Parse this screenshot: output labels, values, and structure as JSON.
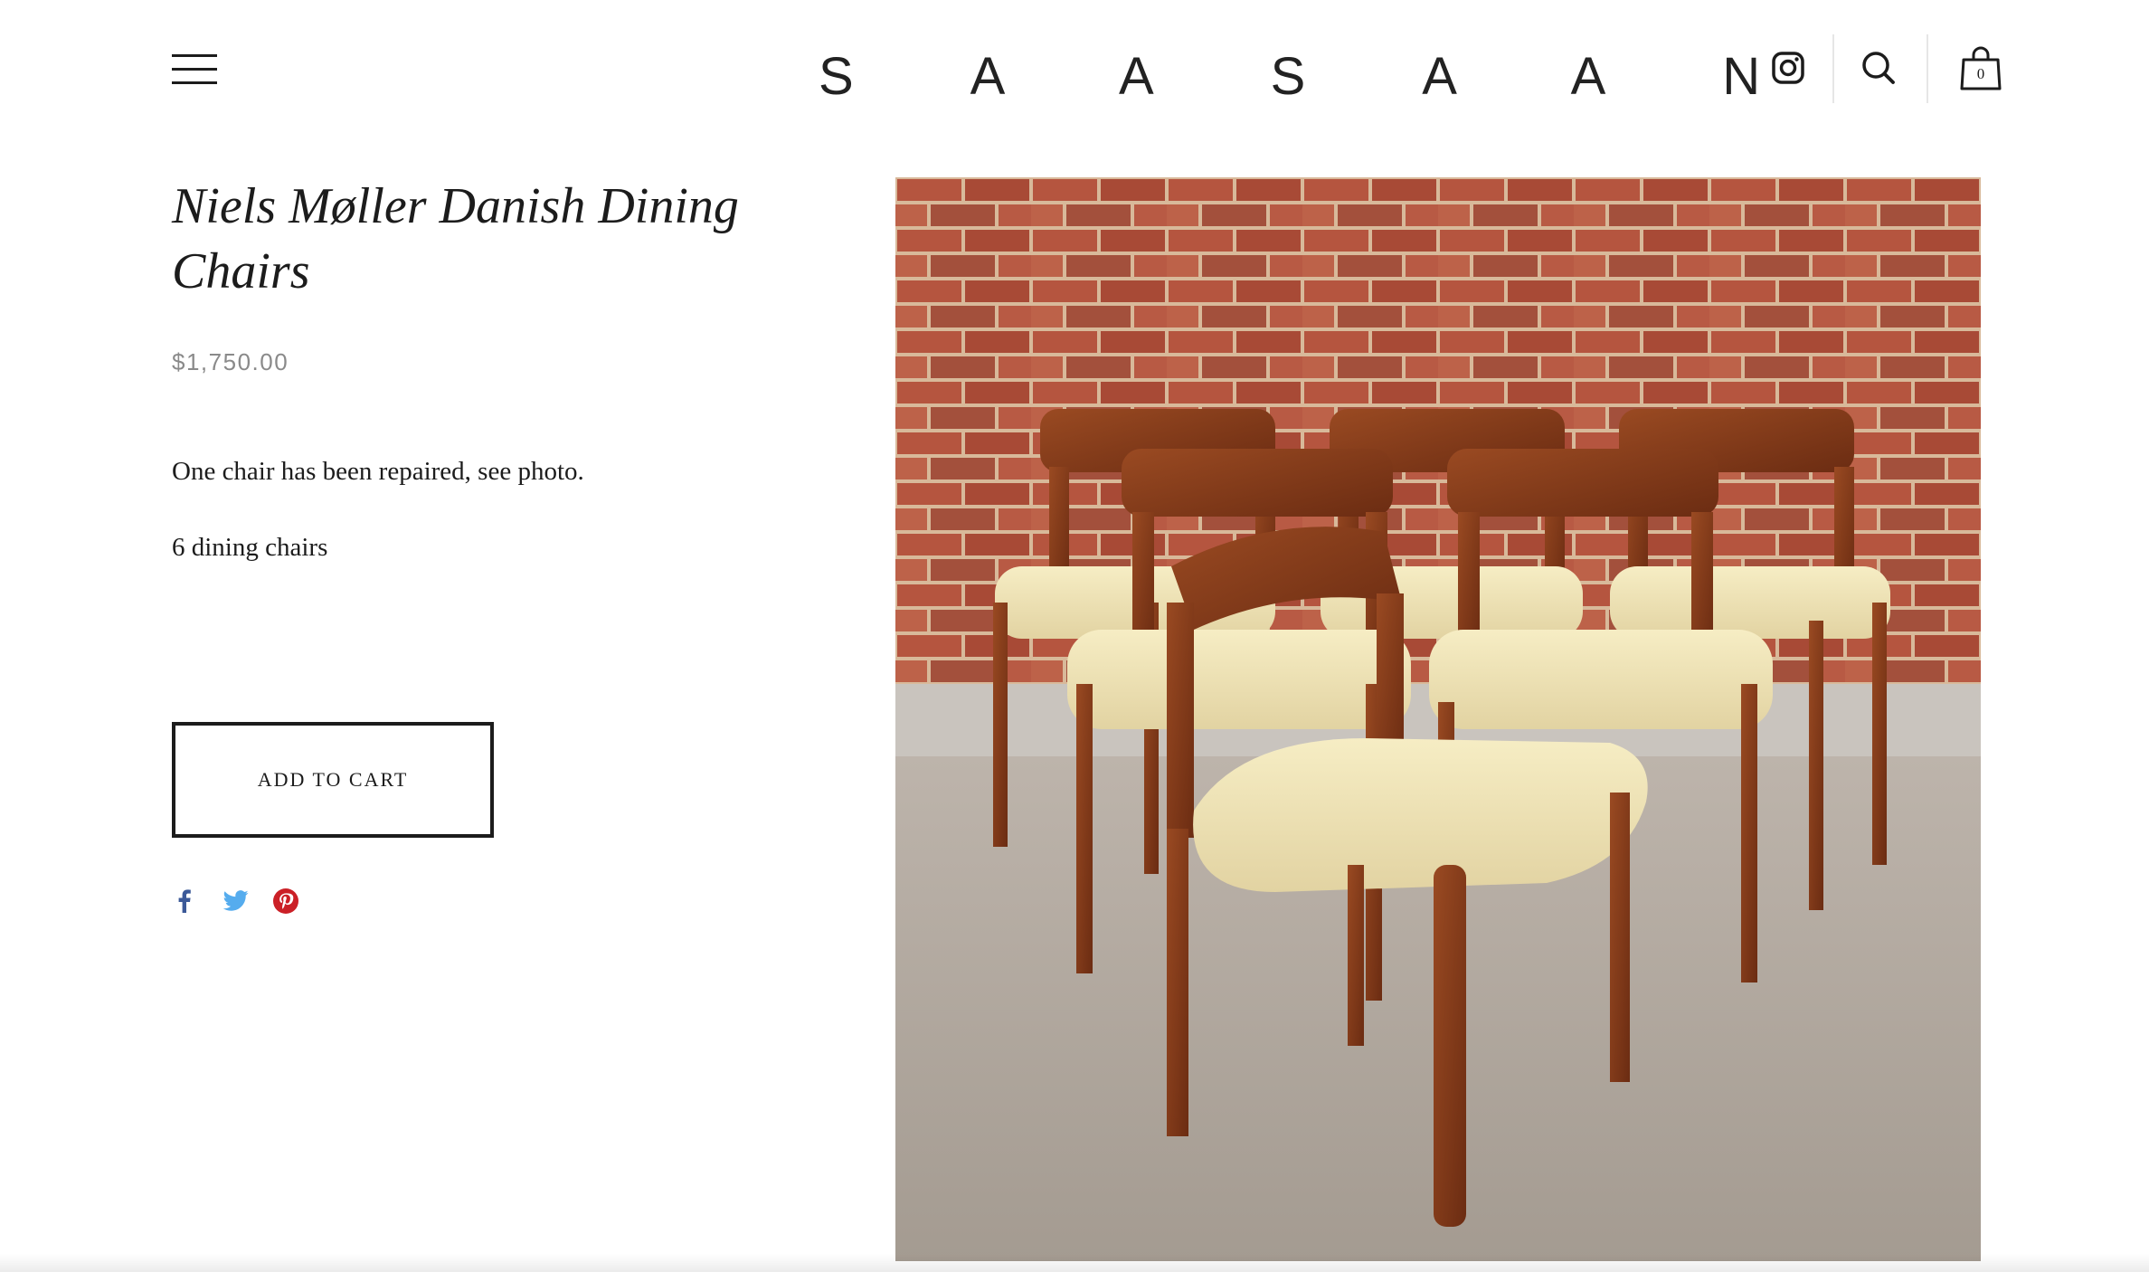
{
  "header": {
    "logo": "S A A S A A N",
    "cart_count": "0",
    "icons": [
      "menu-icon",
      "instagram-icon",
      "search-icon",
      "shopping-bag-icon"
    ]
  },
  "product": {
    "title": "Niels Møller Danish Dining Chairs",
    "price": "$1,750.00",
    "description_lines": [
      "One chair has been repaired, see photo.",
      "6 dining chairs"
    ],
    "add_to_cart_label": "ADD TO CART",
    "image_subject": "product-photo"
  },
  "share": {
    "icons": [
      "facebook-icon",
      "twitter-icon",
      "pinterest-icon"
    ],
    "colors": {
      "facebook": "#3b5998",
      "twitter": "#55acee",
      "pinterest": "#cb2027"
    }
  },
  "colors": {
    "text": "#1c1c1c",
    "price": "#8a8a8a",
    "background": "#ffffff"
  }
}
